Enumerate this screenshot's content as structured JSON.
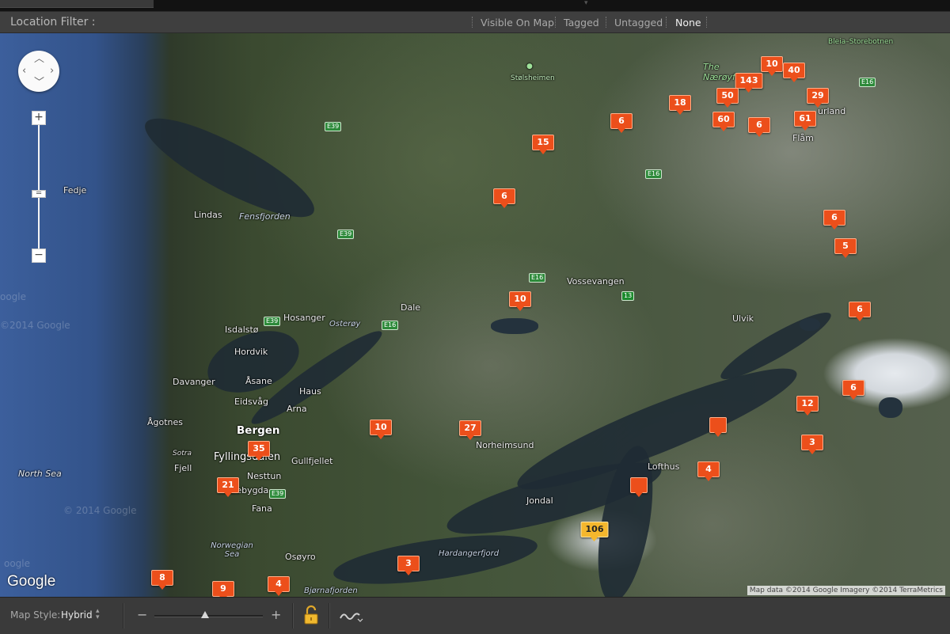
{
  "filter_bar": {
    "title": "Location Filter :",
    "options": [
      "Visible On Map",
      "Tagged",
      "Untagged",
      "None"
    ],
    "selected": "None"
  },
  "map": {
    "labels": {
      "fedje": "Fedje",
      "lindas": "Lindas",
      "fensfjorden": "Fensfjorden",
      "hosanger": "Hosanger",
      "isdalsto": "Isdalstø",
      "osteroy": "Osterøy",
      "hordvik": "Hordvik",
      "asane": "Åsane",
      "haus": "Haus",
      "davanger": "Davanger",
      "eidsvag": "Eidsvåg",
      "arna": "Arna",
      "agotnes": "Ågotnes",
      "bergen": "Bergen",
      "sotra": "Sotra",
      "fyllingsdalen": "Fyllingsdalen",
      "gullfjellet": "Gullfjellet",
      "fjell": "Fjell",
      "nesttun": "Nesttun",
      "ytrebygda": "Ytrebygda",
      "north_sea": "North Sea",
      "fana": "Fana",
      "norwegian_sea": "Norwegian Sea",
      "osoyro": "Osøyro",
      "bjornafjorden": "Bjørnafjorden",
      "hardangerfjord": "Hardangerfjord",
      "jondal": "Jondal",
      "norheimsund": "Norheimsund",
      "lofthus": "Lofthus",
      "ulvik": "Ulvik",
      "vossevangen": "Vossevangen",
      "dale": "Dale",
      "stolsheimen": "Stølsheimen",
      "naeroyfjord": "The Nærøyf",
      "aurland": "urland",
      "flam": "Flåm",
      "bleia": "Bleia–Storebotnen"
    },
    "road_shields": {
      "e39_a": "E39",
      "e39_b": "E39",
      "e39_c": "E39",
      "e39_d": "E39",
      "e16_a": "E16",
      "e16_b": "E16",
      "e16_c": "E16",
      "e16_d": "E16",
      "e16_e": "E16",
      "r13": "13"
    },
    "pins": {
      "p10a": "10",
      "p40": "40",
      "p143": "143",
      "p50": "50",
      "p29": "29",
      "p18": "18",
      "p60": "60",
      "p6a": "6",
      "p61": "61",
      "p6b": "6",
      "p15": "15",
      "p6c": "6",
      "p6d": "6",
      "p5": "5",
      "p10b": "10",
      "p6e": "6",
      "p6f": "6",
      "p12": "12",
      "p10c": "10",
      "p27": "27",
      "p3a": "3",
      "pblank1": "",
      "p35": "35",
      "p4a": "4",
      "p21": "21",
      "pblank2": "",
      "p106": "106",
      "p3b": "3",
      "p8": "8",
      "p9": "9",
      "p4b": "4"
    },
    "google_logo": "Google",
    "attribution": "Map data ©2014 Google Imagery ©2014 TerraMetrics"
  },
  "status_bar": {
    "map_style_label": "Map Style:",
    "map_style_value": "Hybrid",
    "zoom_out": "−",
    "zoom_in": "+",
    "zoom_level": 0.47
  }
}
